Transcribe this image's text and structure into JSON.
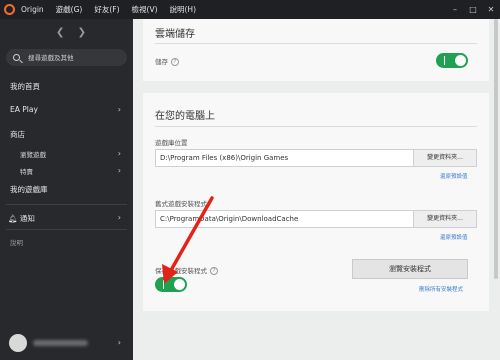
{
  "menubar": {
    "items": [
      "Origin",
      "遊戲(G)",
      "好友(F)",
      "檢視(V)",
      "說明(H)"
    ],
    "window_controls": [
      "–",
      "□",
      "✕"
    ]
  },
  "sidebar": {
    "search_placeholder": "搜尋遊戲及其他",
    "nav": {
      "home": "我的首頁",
      "ea_play": "EA Play",
      "store": "商店",
      "browse_games": "瀏覽遊戲",
      "deals": "特賣",
      "library": "我的遊戲庫",
      "notifications": "通知",
      "help": "說明"
    }
  },
  "main": {
    "cloud": {
      "title": "雲端儲存",
      "storage_label": "儲存",
      "toggle_on": true
    },
    "computer": {
      "title": "在您的電腦上",
      "library_location_label": "遊戲庫位置",
      "library_path": "D:\\Program Files (x86)\\Origin Games",
      "change_folder": "變更資料夾...",
      "restore_default": "還原預設值",
      "installer_label": "舊式遊戲安裝程式",
      "installer_path": "C:\\ProgramData\\Origin\\DownloadCache",
      "keep_installer_label": "保存遊戲安裝程式",
      "keep_installer_on": true,
      "browse_installers": "瀏覽安裝程式",
      "delete_installers": "刪除所有安裝程式"
    }
  },
  "colors": {
    "toggle_green": "#1fa151",
    "annotation_arrow": "#e2231a",
    "link_blue": "#3b7bd1"
  }
}
